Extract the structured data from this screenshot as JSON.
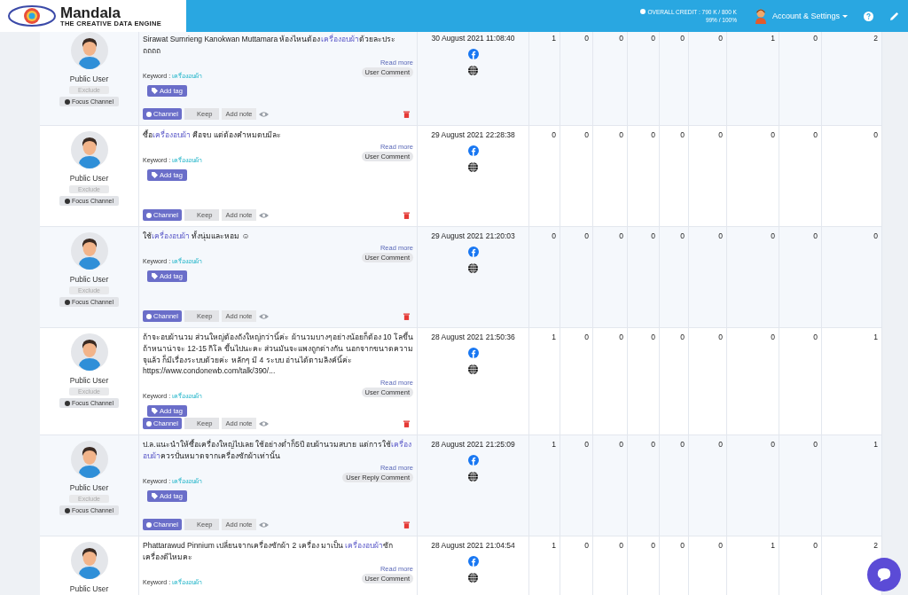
{
  "header": {
    "logo_name": "Mandala",
    "logo_tagline": "THE CREATIVE DATA ENGINE",
    "credit_label": "OVERALL CREDIT : 790 K / 800 K",
    "credit_percent": "99% / 100%",
    "account_menu": "Account & Settings"
  },
  "rows": [
    {
      "user": "Public User",
      "exclude": "Exclude",
      "focus": "Focus Channel",
      "message": [
        {
          "text": "Sirawat Sumrieng Kanokwan Muttamara ห้องไหนต้อง",
          "highlight": false
        },
        {
          "text": "เครื่องอบผ้า",
          "highlight": true
        },
        {
          "text": "ด้วยละประ ถถถถ",
          "highlight": false
        }
      ],
      "keyword_label": "Keyword :",
      "keyword": "เครื่องอบผ้า",
      "read_more": "Read more",
      "type": "User Comment",
      "add_tag": "Add tag",
      "channel": "Channel",
      "keep": "Keep",
      "add_note": "Add note",
      "date": "30 August 2021 11:08:40",
      "counts": [
        "1",
        "0",
        "0",
        "0",
        "0",
        "0",
        "1",
        "0",
        "2"
      ]
    },
    {
      "user": "Public User",
      "exclude": "Exclude",
      "focus": "Focus Channel",
      "message": [
        {
          "text": "ซื้อ",
          "highlight": false
        },
        {
          "text": "เครื่องอบผ้า",
          "highlight": true
        },
        {
          "text": " คือจบ แต่ต้องคำหมดบมีละ",
          "highlight": false
        }
      ],
      "keyword_label": "Keyword :",
      "keyword": "เครื่องอบผ้า",
      "read_more": "Read more",
      "type": "User Comment",
      "add_tag": "Add tag",
      "channel": "Channel",
      "keep": "Keep",
      "add_note": "Add note",
      "date": "29 August 2021 22:28:38",
      "counts": [
        "0",
        "0",
        "0",
        "0",
        "0",
        "0",
        "0",
        "0",
        "0"
      ]
    },
    {
      "user": "Public User",
      "exclude": "Exclude",
      "focus": "Focus Channel",
      "message": [
        {
          "text": "ใช้",
          "highlight": false
        },
        {
          "text": "เครื่องอบผ้า",
          "highlight": true
        },
        {
          "text": " ทั้งนุ่มและหอม ☺",
          "highlight": false
        }
      ],
      "keyword_label": "Keyword :",
      "keyword": "เครื่องอบผ้า",
      "read_more": "Read more",
      "type": "User Comment",
      "add_tag": "Add tag",
      "channel": "Channel",
      "keep": "Keep",
      "add_note": "Add note",
      "date": "29 August 2021 21:20:03",
      "counts": [
        "0",
        "0",
        "0",
        "0",
        "0",
        "0",
        "0",
        "0",
        "0"
      ]
    },
    {
      "user": "Public User",
      "exclude": "Exclude",
      "focus": "Focus Channel",
      "message": [
        {
          "text": "ถ้าจะอบผ้านวม ส่วนใหญ่ต้องถังใหญ่กว่านี้ค่ะ ผ้านวมบางๆอย่างน้อยก็ต้อง 10 โลขึ้น ถ้าหนาน่าจะ 12-15 กิโล ขึ้นไปนะคะ ส่วนมันจะแพงถูกต่างกัน นอกจากขนาดความจุแล้ว ก็มีเรื่องระบบด้วยค่ะ หลักๆ มี 4 ระบบ อ่านได้ตามลิงค์นี้ค่ะ https://www.condonewb.com/talk/390/...",
          "highlight": false
        }
      ],
      "keyword_label": "Keyword :",
      "keyword": "เครื่องอบผ้า",
      "read_more": "Read more",
      "type": "User Comment",
      "add_tag": "Add tag",
      "channel": "Channel",
      "keep": "Keep",
      "add_note": "Add note",
      "date": "28 August 2021 21:50:36",
      "counts": [
        "1",
        "0",
        "0",
        "0",
        "0",
        "0",
        "0",
        "0",
        "1"
      ]
    },
    {
      "user": "Public User",
      "exclude": "Exclude",
      "focus": "Focus Channel",
      "message": [
        {
          "text": "ป.ล.แนะนำให้ซื้อเครื่องใหญ่ไปเลย ใช้อย่างต่ำก็5ปี อบผ้านวมสบาย แต่การใช้",
          "highlight": false
        },
        {
          "text": "เครื่องอบผ้า",
          "highlight": true
        },
        {
          "text": "ควรปั่นหมาดจากเครื่องซักผ้าเท่านั้น",
          "highlight": false
        }
      ],
      "keyword_label": "Keyword :",
      "keyword": "เครื่องอบผ้า",
      "read_more": "Read more",
      "type": "User Reply Comment",
      "add_tag": "Add tag",
      "channel": "Channel",
      "keep": "Keep",
      "add_note": "Add note",
      "date": "28 August 2021 21:25:09",
      "counts": [
        "1",
        "0",
        "0",
        "0",
        "0",
        "0",
        "0",
        "0",
        "1"
      ]
    },
    {
      "user": "Public User",
      "message": [
        {
          "text": "Phattarawud Pinnium เปลี่ยนจากเครื่องซักผ้า 2 เครื่อง มาเป็น ",
          "highlight": false
        },
        {
          "text": "เครื่องอบผ้า",
          "highlight": true
        },
        {
          "text": "ซักเครื่องดีไหมคะ",
          "highlight": false
        }
      ],
      "keyword_label": "Keyword :",
      "keyword": "เครื่องอบผ้า",
      "read_more": "Read more",
      "type": "User Comment",
      "date": "28 August 2021 21:04:54",
      "counts": [
        "1",
        "0",
        "0",
        "0",
        "0",
        "0",
        "1",
        "0",
        "2"
      ]
    }
  ]
}
